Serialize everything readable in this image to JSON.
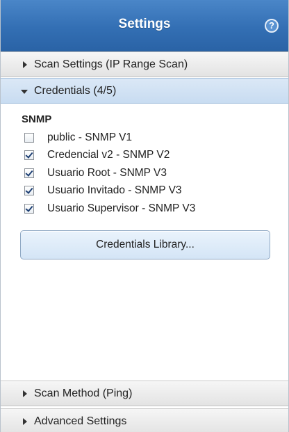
{
  "header": {
    "title": "Settings",
    "help_icon": "question-mark"
  },
  "sections": {
    "scan_settings": {
      "label": "Scan Settings (IP Range Scan)"
    },
    "credentials": {
      "label": "Credentials (4/5)"
    },
    "scan_method": {
      "label": "Scan Method (Ping)"
    },
    "advanced": {
      "label": "Advanced Settings"
    }
  },
  "credentials_panel": {
    "group_title": "SNMP",
    "items": [
      {
        "label": "public - SNMP V1",
        "checked": false
      },
      {
        "label": "Credencial v2 - SNMP V2",
        "checked": true
      },
      {
        "label": "Usuario Root - SNMP V3",
        "checked": true
      },
      {
        "label": "Usuario Invitado - SNMP V3",
        "checked": true
      },
      {
        "label": "Usuario Supervisor - SNMP V3",
        "checked": true
      }
    ],
    "library_button": "Credentials Library..."
  },
  "colors": {
    "header": "#336fb4",
    "active_section": "#c8dcf1",
    "button": "#d4e5f6"
  }
}
